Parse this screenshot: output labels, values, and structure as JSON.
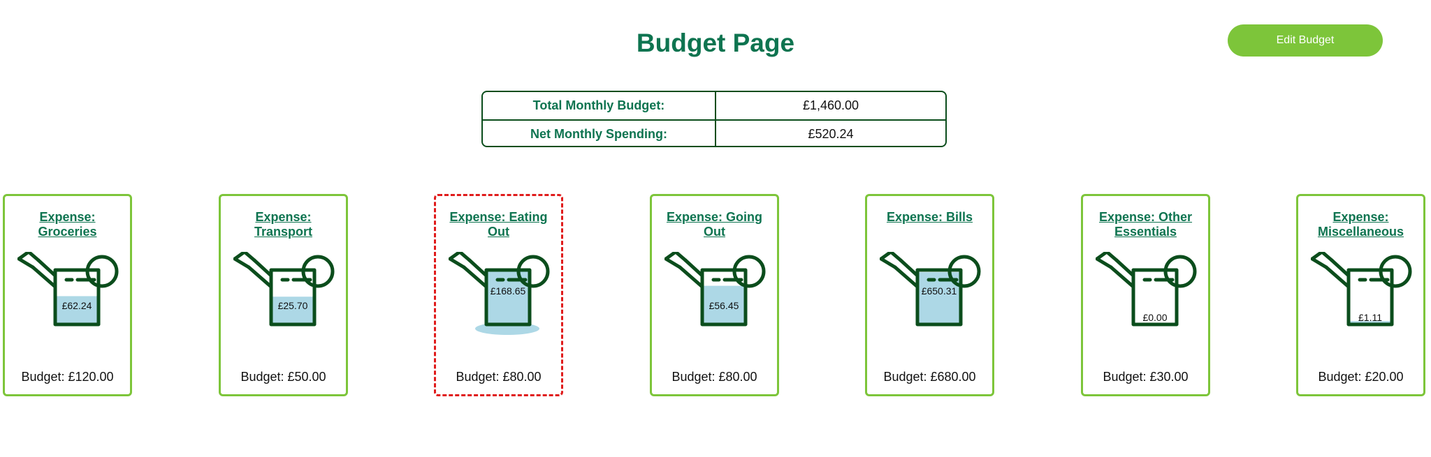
{
  "header": {
    "title": "Budget Page",
    "edit_button": "Edit Budget"
  },
  "summary": {
    "rows": [
      {
        "label": "Total Monthly Budget:",
        "value": "£1,460.00"
      },
      {
        "label": "Net Monthly Spending:",
        "value": "£520.24"
      }
    ]
  },
  "colors": {
    "title": "#0e7450",
    "button": "#7dc53a",
    "card_border": "#7dc53a",
    "card_border_over": "#e01b1b",
    "can_outline": "#0b4d1c",
    "water": "#add8e6"
  },
  "icons": {
    "can": "watering-can-icon"
  },
  "expenses": [
    {
      "title": "Expense: Groceries",
      "spent": "£62.24",
      "budget_label": "Budget: £120.00",
      "fill_fraction": 0.52,
      "over_budget": false
    },
    {
      "title": "Expense: Transport",
      "spent": "£25.70",
      "budget_label": "Budget: £50.00",
      "fill_fraction": 0.51,
      "over_budget": false
    },
    {
      "title": "Expense: Eating Out",
      "spent": "£168.65",
      "budget_label": "Budget: £80.00",
      "fill_fraction": 1.0,
      "over_budget": true
    },
    {
      "title": "Expense: Going Out",
      "spent": "£56.45",
      "budget_label": "Budget: £80.00",
      "fill_fraction": 0.71,
      "over_budget": false
    },
    {
      "title": "Expense: Bills",
      "spent": "£650.31",
      "budget_label": "Budget: £680.00",
      "fill_fraction": 0.96,
      "over_budget": false
    },
    {
      "title": "Expense: Other Essentials",
      "spent": "£0.00",
      "budget_label": "Budget: £30.00",
      "fill_fraction": 0.0,
      "over_budget": false
    },
    {
      "title": "Expense: Miscellaneous",
      "spent": "£1.11",
      "budget_label": "Budget: £20.00",
      "fill_fraction": 0.06,
      "over_budget": false
    }
  ]
}
